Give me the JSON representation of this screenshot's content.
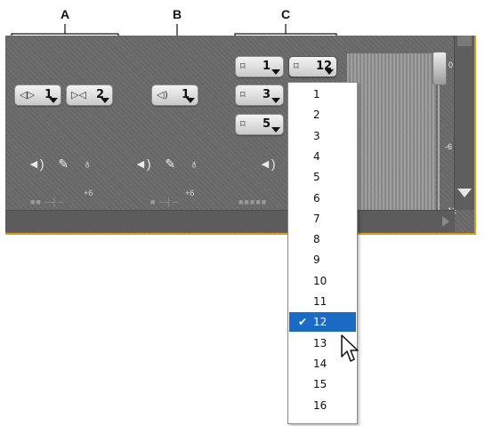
{
  "callouts": {
    "a": "A",
    "b": "B",
    "c": "C"
  },
  "group_a": {
    "button1": {
      "icon": "stereo-icon",
      "value": "1"
    },
    "button2": {
      "icon": "right-speaker-icon",
      "value": "2"
    }
  },
  "group_b": {
    "button1": {
      "icon": "speaker-icon",
      "value": "1"
    }
  },
  "group_c": {
    "buttons": [
      {
        "icon": "channel-frame-icon",
        "value": "1"
      },
      {
        "icon": "channel-frame-icon",
        "value": "12"
      },
      {
        "icon": "channel-frame-marked-icon",
        "value": "3"
      },
      {
        "icon": "channel-frame-icon",
        "value": "5"
      }
    ]
  },
  "tick_labels": {
    "a": "+6",
    "b": "+6"
  },
  "meter_labels": {
    "zero": "0",
    "minus6": "-6",
    "minus12": "-12"
  },
  "dropdown": {
    "items": [
      "1",
      "2",
      "3",
      "4",
      "5",
      "6",
      "7",
      "8",
      "9",
      "10",
      "11",
      "12",
      "13",
      "14",
      "15",
      "16"
    ],
    "selected": "12"
  },
  "colors": {
    "panel_border": "#d4a017",
    "selection": "#1b6bc6"
  }
}
